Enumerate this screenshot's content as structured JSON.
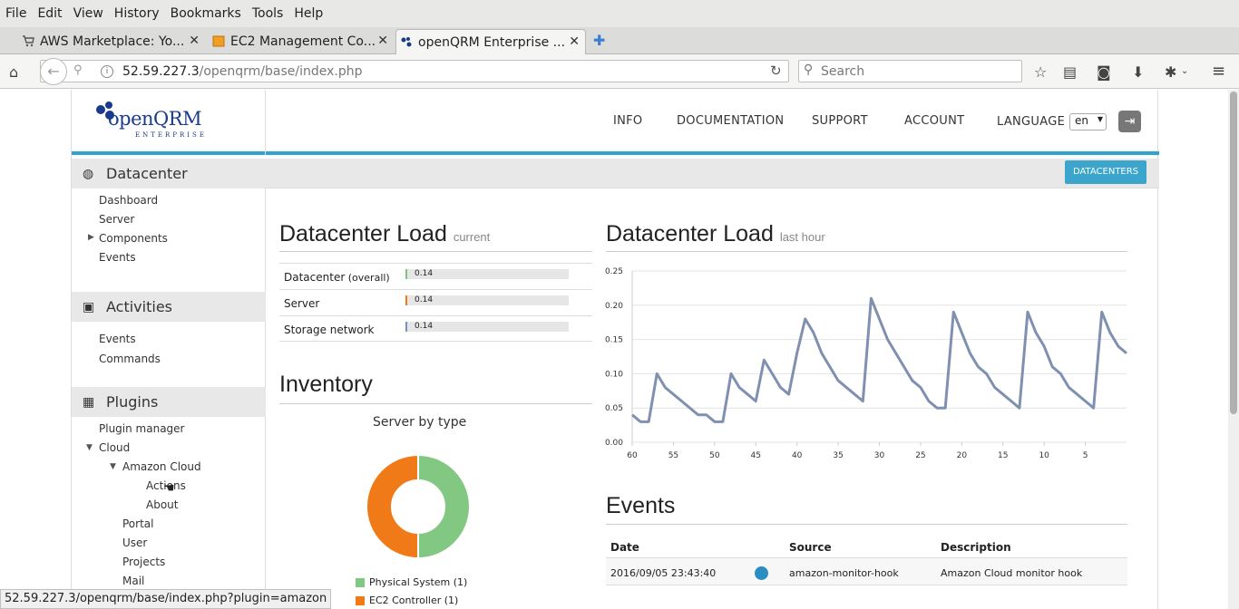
{
  "menu": [
    "File",
    "Edit",
    "View",
    "History",
    "Bookmarks",
    "Tools",
    "Help"
  ],
  "tabs": [
    {
      "label": "AWS Marketplace: Yo...",
      "icon": "cart-icon"
    },
    {
      "label": "EC2 Management Co...",
      "icon": "aws-box-icon"
    },
    {
      "label": "openQRM Enterprise ...",
      "icon": "openqrm-icon"
    }
  ],
  "url": {
    "host": "52.59.227.3",
    "path": "/openqrm/base/index.php"
  },
  "search_placeholder": "Search",
  "logo": {
    "main": "openQRM",
    "sub": "ENTERPRISE"
  },
  "topnav": [
    "INFO",
    "DOCUMENTATION",
    "SUPPORT",
    "ACCOUNT",
    "LANGUAGE"
  ],
  "language_value": "en",
  "datacenters_button": "DATACENTERS",
  "sidebar": {
    "datacenter": {
      "title": "Datacenter",
      "items": [
        "Dashboard",
        "Server",
        "Components",
        "Events"
      ]
    },
    "activities": {
      "title": "Activities",
      "items": [
        "Events",
        "Commands"
      ]
    },
    "plugins": {
      "title": "Plugins",
      "items": [
        "Plugin manager",
        "Cloud",
        "Amazon Cloud",
        "Actions",
        "About",
        "Portal",
        "User",
        "Projects",
        "Mail"
      ]
    }
  },
  "load_current": {
    "title": "Datacenter Load",
    "subtitle": "current",
    "rows": [
      {
        "label": "Datacenter",
        "sub": " (overall)",
        "value": "0.14",
        "color": "#7ec47e"
      },
      {
        "label": "Server",
        "sub": "",
        "value": "0.14",
        "color": "#f07a18"
      },
      {
        "label": "Storage network",
        "sub": "",
        "value": "0.14",
        "color": "#7f8ec4"
      }
    ]
  },
  "inventory": {
    "title": "Inventory",
    "chart_title": "Server by type",
    "legend": [
      {
        "label": "Physical System (1)",
        "color": "#82c882"
      },
      {
        "label": "EC2 Controller (1)",
        "color": "#f07a18"
      }
    ]
  },
  "chart_data": {
    "type": "line",
    "title": "Datacenter Load",
    "subtitle": "last hour",
    "x": [
      60,
      59,
      58,
      57,
      56,
      55,
      54,
      53,
      52,
      51,
      50,
      49,
      48,
      47,
      46,
      45,
      44,
      43,
      42,
      41,
      40,
      39,
      38,
      37,
      36,
      35,
      34,
      33,
      32,
      31,
      30,
      29,
      28,
      27,
      26,
      25,
      24,
      23,
      22,
      21,
      20,
      19,
      18,
      17,
      16,
      15,
      14,
      13,
      12,
      11,
      10,
      9,
      8,
      7,
      6,
      5,
      4,
      3,
      2,
      1,
      0
    ],
    "xticks": [
      60,
      55,
      50,
      45,
      40,
      35,
      30,
      25,
      20,
      15,
      10,
      5
    ],
    "yticks": [
      "0.00",
      "0.05",
      "0.10",
      "0.15",
      "0.20",
      "0.25"
    ],
    "ylim": [
      0,
      0.25
    ],
    "series": [
      {
        "values": [
          0.04,
          0.03,
          0.03,
          0.1,
          0.08,
          0.07,
          0.06,
          0.05,
          0.04,
          0.04,
          0.03,
          0.03,
          0.1,
          0.08,
          0.07,
          0.06,
          0.12,
          0.1,
          0.08,
          0.07,
          0.13,
          0.18,
          0.16,
          0.13,
          0.11,
          0.09,
          0.08,
          0.07,
          0.06,
          0.21,
          0.18,
          0.15,
          0.13,
          0.11,
          0.09,
          0.08,
          0.06,
          0.05,
          0.05,
          0.19,
          0.16,
          0.13,
          0.11,
          0.1,
          0.08,
          0.07,
          0.06,
          0.05,
          0.19,
          0.16,
          0.14,
          0.11,
          0.1,
          0.08,
          0.07,
          0.06,
          0.05,
          0.19,
          0.16,
          0.14,
          0.13
        ]
      }
    ]
  },
  "events": {
    "title": "Events",
    "headers": [
      "Date",
      "Source",
      "Description"
    ],
    "rows": [
      {
        "date": "2016/09/05 23:43:40",
        "source": "amazon-monitor-hook",
        "description": "Amazon Cloud monitor hook",
        "status_color": "#2a8fc0"
      }
    ]
  },
  "statusbar": "52.59.227.3/openqrm/base/index.php?plugin=amazon"
}
